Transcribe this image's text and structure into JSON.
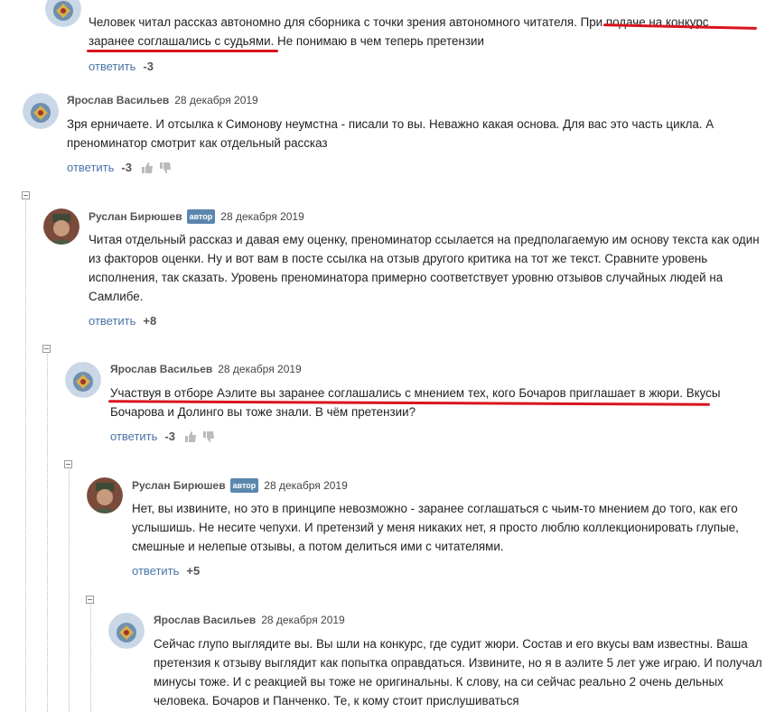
{
  "comments": [
    {
      "text": "Человек читал рассказ автономно для сборника с точки зрения автономного читателя. При подаче на конкурс заранее соглашались с судьями. Не понимаю в чем теперь претензии",
      "reply": "ответить",
      "score": "-3"
    },
    {
      "author": "Ярослав Васильев",
      "date": "28 декабря 2019",
      "text": "Зря ерничаете. И отсылка к Симонову неумстна - писали то вы. Неважно какая основа. Для  вас это часть цикла. А преноминатор смотрит как отдельный рассказ",
      "reply": "ответить",
      "score": "-3"
    },
    {
      "author": "Руслан Бирюшев",
      "badge": "автор",
      "date": "28 декабря 2019",
      "text": "Читая отдельный рассказ и давая ему оценку, преноминатор ссылается на предполагаемую им основу текста как один из факторов оценки. Ну и вот вам в посте ссылка на отзыв другого критика на тот же текст. Сравните уровень исполнения, так сказать. Уровень преноминатора примерно соответствует уровню отзывов случайных людей на Самлибе.",
      "reply": "ответить",
      "score": "+8"
    },
    {
      "author": "Ярослав Васильев",
      "date": "28 декабря 2019",
      "text": "Участвуя в отборе Аэлите вы заранее соглашались с мнением тех, кого Бочаров приглашает в жюри. Вкусы Бочарова и Долинго вы тоже знали. В чём претензии?",
      "reply": "ответить",
      "score": "-3"
    },
    {
      "author": "Руслан Бирюшев",
      "badge": "автор",
      "date": "28 декабря 2019",
      "text": "Нет, вы извините, но это в принципе невозможно - заранее соглашаться с чьим-то мнением до того, как его услышишь. Не несите чепухи. И претензий у меня никаких нет, я просто люблю коллекционировать глупые, смешные и нелепые отзывы, а потом делиться ими с читателями.",
      "reply": "ответить",
      "score": "+5"
    },
    {
      "author": "Ярослав Васильев",
      "date": "28 декабря 2019",
      "text": "Сейчас глупо выглядите вы. Вы шли на конкурс, где судит жюри. Состав и его вкусы вам известны. Ваша претензия к отзыву выглядит как попытка оправдаться. Извините, но я в аэлите 5 лет уже играю. И получал минусы тоже. И с реакцией вы тоже не оригинальны. К слову, на си сейчас реально 2 очень дельных человека. Бочаров и Панченко. Те, к кому стоит прислушиваться"
    }
  ]
}
